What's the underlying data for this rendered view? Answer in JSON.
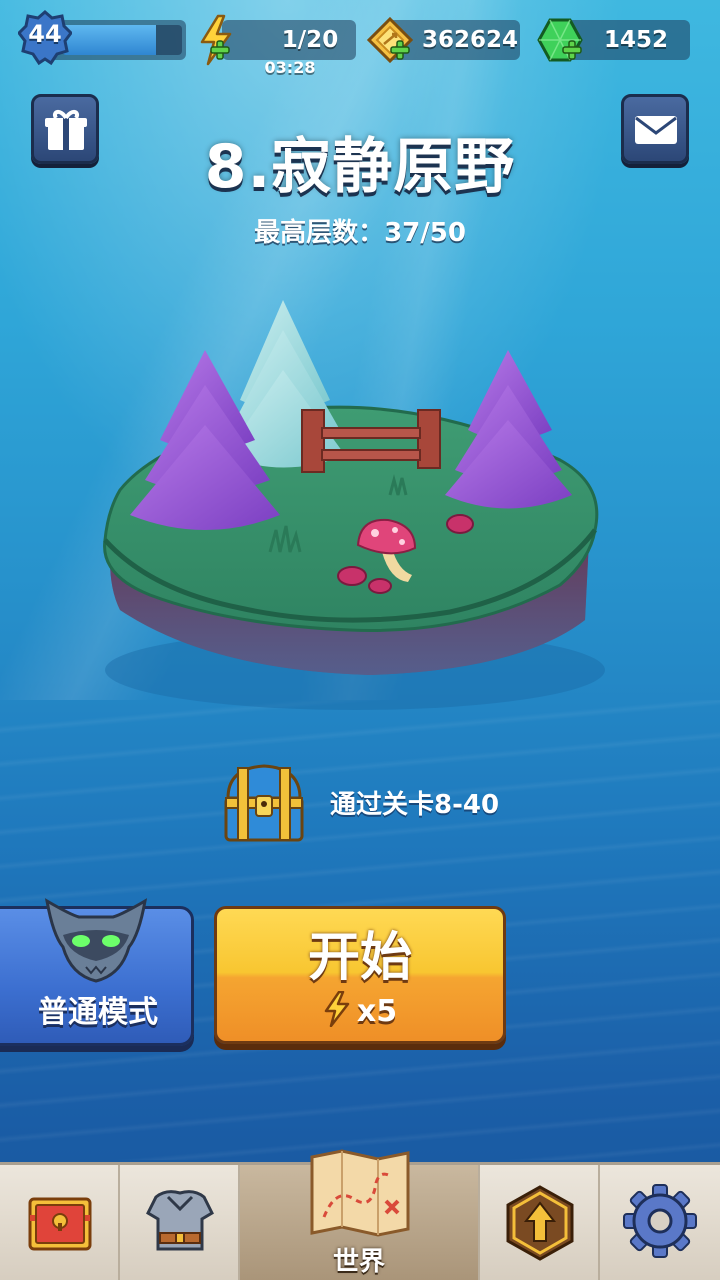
{
  "top_bar": {
    "level": "44",
    "xp_progress": 0.78,
    "energy": "1/20",
    "energy_timer": "03:28",
    "coins": "362624",
    "gems": "1452"
  },
  "stage": {
    "title": "8.寂静原野",
    "best_floors": "最高层数：37/50"
  },
  "reward": {
    "text": "通过关卡8-40"
  },
  "mode_button": {
    "label": "普通模式"
  },
  "start_button": {
    "label": "开始",
    "cost": "x5"
  },
  "bottom_nav": {
    "tabs": [
      {
        "icon": "shop-chest-icon"
      },
      {
        "icon": "armor-icon"
      },
      {
        "icon": "world-map-icon",
        "label": "世界",
        "active": true
      },
      {
        "icon": "upgrade-arrow-icon"
      },
      {
        "icon": "settings-gear-icon"
      }
    ]
  },
  "colors": {
    "start_button": "#f8c631",
    "mode_button": "#3c6fd0",
    "ocean": "#2792cc",
    "gem": "#3fd15a"
  }
}
